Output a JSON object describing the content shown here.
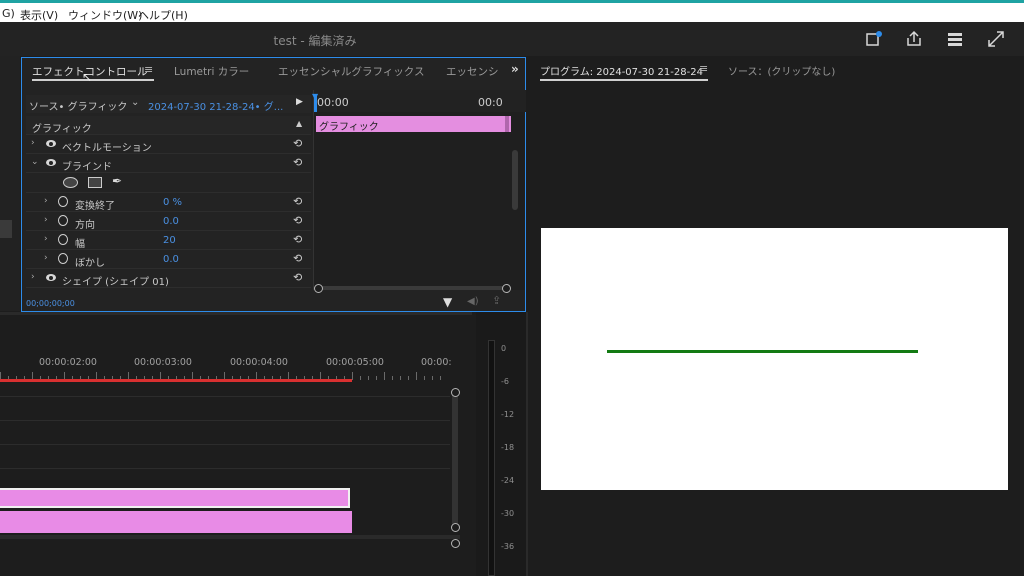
{
  "menubar": {
    "partial": "G)",
    "items": [
      "表示(V)",
      "ウィンドウ(W)",
      "ヘルプ(H)"
    ]
  },
  "titlebar": {
    "title": "test - 編集済み"
  },
  "effect_controls": {
    "tabs": [
      "エフェクトコントロール",
      "Lumetri カラー",
      "エッセンシャルグラフィックス",
      "エッセンシ"
    ],
    "active_tab": "エフェクトコントロール",
    "source_label": "ソース• グラフィック",
    "sequence_label": "2024-07-30  21-28-24• グ...",
    "timeline_start": "00:00",
    "timeline_end": "00:0",
    "clip_label": "グラフィック",
    "section_header": "グラフィック",
    "rows": [
      {
        "label": "ベクトルモーション"
      },
      {
        "label": "ブラインド"
      },
      {
        "label": "変換終了",
        "value": "0 %"
      },
      {
        "label": "方向",
        "value": "0.0"
      },
      {
        "label": "幅",
        "value": "20"
      },
      {
        "label": "ぼかし",
        "value": "0.0"
      },
      {
        "label": "シェイプ (シェイプ 01)"
      }
    ],
    "footer_timecode": "00;00;00;00"
  },
  "program": {
    "tab_label": "プログラム: 2024-07-30 21-28-24",
    "source_tab": "ソース：(クリップなし)",
    "line_color": "#137a13",
    "screen_color": "#ffffff"
  },
  "timeline": {
    "timecodes": [
      "00:00:02:00",
      "00:00:03:00",
      "00:00:04:00",
      "00:00:05:00",
      "00:00:"
    ],
    "clip_color": "#e88be6",
    "playhead_color": "#d93030"
  },
  "audio_meter": {
    "db_labels": [
      "0",
      "-6",
      "-12",
      "-18",
      "-24",
      "-30",
      "-36"
    ]
  }
}
